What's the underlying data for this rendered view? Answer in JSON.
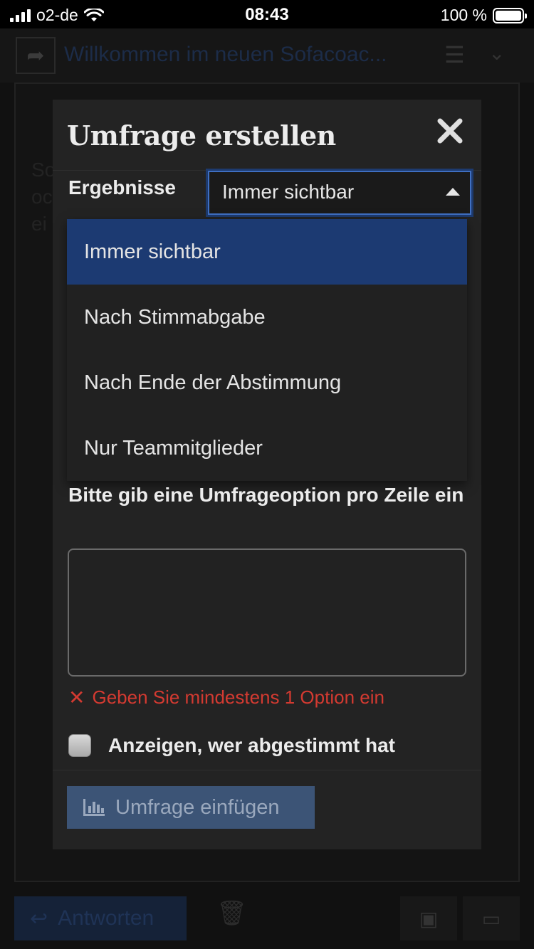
{
  "status_bar": {
    "carrier": "o2-de",
    "time": "08:43",
    "battery_percent": "100 %"
  },
  "background": {
    "topic_title": "Willkommen im neuen Sofacoac...",
    "text_fragments": [
      "So",
      "oc",
      "ei"
    ],
    "reply_label": "Antworten"
  },
  "modal": {
    "title": "Umfrage erstellen",
    "results_label": "Ergebnisse",
    "results_select": {
      "selected": "Immer sichtbar",
      "options": [
        "Immer sichtbar",
        "Nach Stimmabgabe",
        "Nach Ende der Abstimmung",
        "Nur Teammitglieder"
      ]
    },
    "options_label": "Bitte gib eine Umfrageoption pro Zeile ein",
    "options_value": "",
    "error_message": "Geben Sie mindestens 1 Option ein",
    "show_voters_label": "Anzeigen, wer abgestimmt hat",
    "show_voters_checked": false,
    "insert_button_label": "Umfrage einfügen"
  },
  "colors": {
    "accent": "#1c3a72",
    "error": "#d33a31",
    "insert_button": "#3c5476"
  }
}
